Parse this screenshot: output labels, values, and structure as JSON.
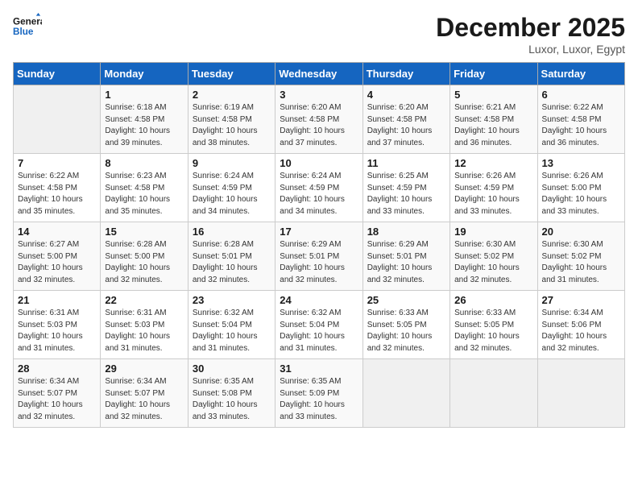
{
  "header": {
    "logo_line1": "General",
    "logo_line2": "Blue",
    "title": "December 2025",
    "subtitle": "Luxor, Luxor, Egypt"
  },
  "weekdays": [
    "Sunday",
    "Monday",
    "Tuesday",
    "Wednesday",
    "Thursday",
    "Friday",
    "Saturday"
  ],
  "weeks": [
    [
      {
        "day": "",
        "info": ""
      },
      {
        "day": "1",
        "info": "Sunrise: 6:18 AM\nSunset: 4:58 PM\nDaylight: 10 hours\nand 39 minutes."
      },
      {
        "day": "2",
        "info": "Sunrise: 6:19 AM\nSunset: 4:58 PM\nDaylight: 10 hours\nand 38 minutes."
      },
      {
        "day": "3",
        "info": "Sunrise: 6:20 AM\nSunset: 4:58 PM\nDaylight: 10 hours\nand 37 minutes."
      },
      {
        "day": "4",
        "info": "Sunrise: 6:20 AM\nSunset: 4:58 PM\nDaylight: 10 hours\nand 37 minutes."
      },
      {
        "day": "5",
        "info": "Sunrise: 6:21 AM\nSunset: 4:58 PM\nDaylight: 10 hours\nand 36 minutes."
      },
      {
        "day": "6",
        "info": "Sunrise: 6:22 AM\nSunset: 4:58 PM\nDaylight: 10 hours\nand 36 minutes."
      }
    ],
    [
      {
        "day": "7",
        "info": "Sunrise: 6:22 AM\nSunset: 4:58 PM\nDaylight: 10 hours\nand 35 minutes."
      },
      {
        "day": "8",
        "info": "Sunrise: 6:23 AM\nSunset: 4:58 PM\nDaylight: 10 hours\nand 35 minutes."
      },
      {
        "day": "9",
        "info": "Sunrise: 6:24 AM\nSunset: 4:59 PM\nDaylight: 10 hours\nand 34 minutes."
      },
      {
        "day": "10",
        "info": "Sunrise: 6:24 AM\nSunset: 4:59 PM\nDaylight: 10 hours\nand 34 minutes."
      },
      {
        "day": "11",
        "info": "Sunrise: 6:25 AM\nSunset: 4:59 PM\nDaylight: 10 hours\nand 33 minutes."
      },
      {
        "day": "12",
        "info": "Sunrise: 6:26 AM\nSunset: 4:59 PM\nDaylight: 10 hours\nand 33 minutes."
      },
      {
        "day": "13",
        "info": "Sunrise: 6:26 AM\nSunset: 5:00 PM\nDaylight: 10 hours\nand 33 minutes."
      }
    ],
    [
      {
        "day": "14",
        "info": "Sunrise: 6:27 AM\nSunset: 5:00 PM\nDaylight: 10 hours\nand 32 minutes."
      },
      {
        "day": "15",
        "info": "Sunrise: 6:28 AM\nSunset: 5:00 PM\nDaylight: 10 hours\nand 32 minutes."
      },
      {
        "day": "16",
        "info": "Sunrise: 6:28 AM\nSunset: 5:01 PM\nDaylight: 10 hours\nand 32 minutes."
      },
      {
        "day": "17",
        "info": "Sunrise: 6:29 AM\nSunset: 5:01 PM\nDaylight: 10 hours\nand 32 minutes."
      },
      {
        "day": "18",
        "info": "Sunrise: 6:29 AM\nSunset: 5:01 PM\nDaylight: 10 hours\nand 32 minutes."
      },
      {
        "day": "19",
        "info": "Sunrise: 6:30 AM\nSunset: 5:02 PM\nDaylight: 10 hours\nand 32 minutes."
      },
      {
        "day": "20",
        "info": "Sunrise: 6:30 AM\nSunset: 5:02 PM\nDaylight: 10 hours\nand 31 minutes."
      }
    ],
    [
      {
        "day": "21",
        "info": "Sunrise: 6:31 AM\nSunset: 5:03 PM\nDaylight: 10 hours\nand 31 minutes."
      },
      {
        "day": "22",
        "info": "Sunrise: 6:31 AM\nSunset: 5:03 PM\nDaylight: 10 hours\nand 31 minutes."
      },
      {
        "day": "23",
        "info": "Sunrise: 6:32 AM\nSunset: 5:04 PM\nDaylight: 10 hours\nand 31 minutes."
      },
      {
        "day": "24",
        "info": "Sunrise: 6:32 AM\nSunset: 5:04 PM\nDaylight: 10 hours\nand 31 minutes."
      },
      {
        "day": "25",
        "info": "Sunrise: 6:33 AM\nSunset: 5:05 PM\nDaylight: 10 hours\nand 32 minutes."
      },
      {
        "day": "26",
        "info": "Sunrise: 6:33 AM\nSunset: 5:05 PM\nDaylight: 10 hours\nand 32 minutes."
      },
      {
        "day": "27",
        "info": "Sunrise: 6:34 AM\nSunset: 5:06 PM\nDaylight: 10 hours\nand 32 minutes."
      }
    ],
    [
      {
        "day": "28",
        "info": "Sunrise: 6:34 AM\nSunset: 5:07 PM\nDaylight: 10 hours\nand 32 minutes."
      },
      {
        "day": "29",
        "info": "Sunrise: 6:34 AM\nSunset: 5:07 PM\nDaylight: 10 hours\nand 32 minutes."
      },
      {
        "day": "30",
        "info": "Sunrise: 6:35 AM\nSunset: 5:08 PM\nDaylight: 10 hours\nand 33 minutes."
      },
      {
        "day": "31",
        "info": "Sunrise: 6:35 AM\nSunset: 5:09 PM\nDaylight: 10 hours\nand 33 minutes."
      },
      {
        "day": "",
        "info": ""
      },
      {
        "day": "",
        "info": ""
      },
      {
        "day": "",
        "info": ""
      }
    ]
  ]
}
